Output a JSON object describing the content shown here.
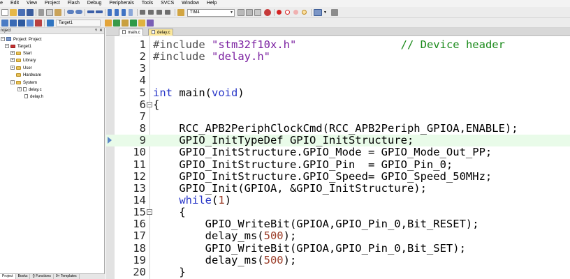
{
  "menu": [
    "ile",
    "Edit",
    "View",
    "Project",
    "Flash",
    "Debug",
    "Peripherals",
    "Tools",
    "SVCS",
    "Window",
    "Help"
  ],
  "toolbar": {
    "target_combo": "TIM4"
  },
  "build_toolbar": {
    "target_select": "Target1"
  },
  "project": {
    "title": "roject",
    "root": "Project: Project",
    "target": "Target1",
    "groups": [
      "Start",
      "Library",
      "User",
      "Hardware",
      "System"
    ],
    "system_files": [
      "delay.c",
      "delay.h"
    ]
  },
  "bottom_tabs": [
    "Project",
    "Books",
    "{} Functions",
    "0+ Templates"
  ],
  "editor": {
    "tabs": [
      "main.c",
      "delay.c"
    ],
    "current_line": 9,
    "lines": [
      {
        "n": "1",
        "fold": "",
        "segs": [
          {
            "t": "#include ",
            "c": "pp"
          },
          {
            "t": "\"stm32f10x.h\"",
            "c": "str"
          },
          {
            "t": "                // Device header",
            "c": "cmt"
          }
        ]
      },
      {
        "n": "2",
        "fold": "",
        "segs": [
          {
            "t": "#include ",
            "c": "pp"
          },
          {
            "t": "\"delay.h\"",
            "c": "str"
          }
        ]
      },
      {
        "n": "3",
        "fold": "",
        "segs": []
      },
      {
        "n": "4",
        "fold": "",
        "segs": []
      },
      {
        "n": "5",
        "fold": "",
        "segs": [
          {
            "t": "int",
            "c": "kw"
          },
          {
            "t": " main(",
            "c": ""
          },
          {
            "t": "void",
            "c": "kw"
          },
          {
            "t": ")",
            "c": ""
          }
        ]
      },
      {
        "n": "6",
        "fold": "−",
        "segs": [
          {
            "t": "{",
            "c": ""
          }
        ]
      },
      {
        "n": "7",
        "fold": "",
        "segs": []
      },
      {
        "n": "8",
        "fold": "",
        "segs": [
          {
            "t": "    RCC_APB2PeriphClockCmd(RCC_APB2Periph_GPIOA,ENABLE);",
            "c": ""
          }
        ]
      },
      {
        "n": "9",
        "fold": "",
        "segs": [
          {
            "t": "    GPIO_InitTypeDef GPIO_InitStructure;",
            "c": ""
          }
        ]
      },
      {
        "n": "10",
        "fold": "",
        "segs": [
          {
            "t": "    GPIO_InitStructure.GPIO_Mode = GPIO_Mode_Out_PP;",
            "c": ""
          }
        ]
      },
      {
        "n": "11",
        "fold": "",
        "segs": [
          {
            "t": "    GPIO_InitStructure.GPIO_Pin  = GPIO_Pin_0;",
            "c": ""
          }
        ]
      },
      {
        "n": "12",
        "fold": "",
        "segs": [
          {
            "t": "    GPIO_InitStructure.GPIO_Speed= GPIO_Speed_50MHz;",
            "c": ""
          }
        ]
      },
      {
        "n": "13",
        "fold": "",
        "segs": [
          {
            "t": "    GPIO_Init(GPIOA, &GPIO_InitStructure);",
            "c": ""
          }
        ]
      },
      {
        "n": "14",
        "fold": "",
        "segs": [
          {
            "t": "    ",
            "c": ""
          },
          {
            "t": "while",
            "c": "kw"
          },
          {
            "t": "(",
            "c": ""
          },
          {
            "t": "1",
            "c": "num"
          },
          {
            "t": ")",
            "c": ""
          }
        ]
      },
      {
        "n": "15",
        "fold": "−",
        "segs": [
          {
            "t": "    {",
            "c": ""
          }
        ]
      },
      {
        "n": "16",
        "fold": "",
        "segs": [
          {
            "t": "        GPIO_WriteBit(GPIOA,GPIO_Pin_0,Bit_RESET);",
            "c": ""
          }
        ]
      },
      {
        "n": "17",
        "fold": "",
        "segs": [
          {
            "t": "        delay_ms(",
            "c": ""
          },
          {
            "t": "500",
            "c": "num"
          },
          {
            "t": ");",
            "c": ""
          }
        ]
      },
      {
        "n": "18",
        "fold": "",
        "segs": [
          {
            "t": "        GPIO_WriteBit(GPIOA,GPIO_Pin_0,Bit_SET);",
            "c": ""
          }
        ]
      },
      {
        "n": "19",
        "fold": "",
        "segs": [
          {
            "t": "        delay_ms(",
            "c": ""
          },
          {
            "t": "500",
            "c": "num"
          },
          {
            "t": ");",
            "c": ""
          }
        ]
      },
      {
        "n": "20",
        "fold": "",
        "segs": [
          {
            "t": "    }",
            "c": ""
          }
        ]
      }
    ]
  },
  "colors": {
    "keyword": "#2a38c8",
    "string": "#7a1fa0",
    "comment": "#1a8a1a",
    "number": "#9a3b26",
    "current_line": "#e9fbe9",
    "tab_active_file": "#fce89a"
  },
  "icons": [
    "new-file-icon",
    "open-icon",
    "save-icon",
    "save-all-icon",
    "cut-icon",
    "copy-icon",
    "paste-icon",
    "undo-icon",
    "redo-icon",
    "bookmark-icon",
    "find-icon",
    "debug-icon",
    "breakpoint-icon",
    "build-icon",
    "rebuild-icon",
    "download-icon",
    "options-icon",
    "project-icon",
    "pin-icon",
    "close-icon",
    "folder-icon",
    "file-icon",
    "bookmark-arrow-icon"
  ]
}
